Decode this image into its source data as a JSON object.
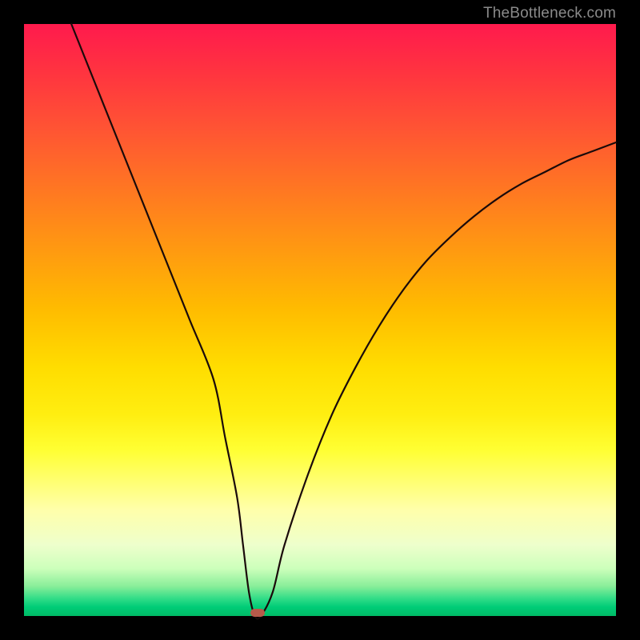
{
  "watermark": "TheBottleneck.com",
  "colors": {
    "frame": "#000000",
    "curve": "#1a0a0a",
    "marker": "#b85a4a",
    "gradient_top": "#ff1a4d",
    "gradient_bottom": "#00bb66"
  },
  "chart_data": {
    "type": "line",
    "title": "",
    "xlabel": "",
    "ylabel": "",
    "xlim": [
      0,
      100
    ],
    "ylim": [
      0,
      100
    ],
    "grid": false,
    "legend": false,
    "series": [
      {
        "name": "bottleneck-curve",
        "x": [
          8,
          12,
          16,
          20,
          24,
          28,
          32,
          34,
          36,
          37,
          38,
          39,
          40,
          42,
          44,
          48,
          52,
          56,
          60,
          64,
          68,
          72,
          76,
          80,
          84,
          88,
          92,
          96,
          100
        ],
        "y": [
          100,
          90,
          80,
          70,
          60,
          50,
          40,
          30,
          20,
          12,
          4,
          0,
          0,
          4,
          12,
          24,
          34,
          42,
          49,
          55,
          60,
          64,
          67.5,
          70.5,
          73,
          75,
          77,
          78.5,
          80
        ]
      }
    ],
    "marker": {
      "x": 39.5,
      "y": 0
    },
    "notes": "Values are estimated from pixel positions; no axis tick labels are present. y=0 is the bottom (green) and y=100 is the top (red). The black curve falls steeply from the top-left, touches zero near x≈39, then rises with decreasing slope toward the right edge reaching roughly y≈80."
  }
}
